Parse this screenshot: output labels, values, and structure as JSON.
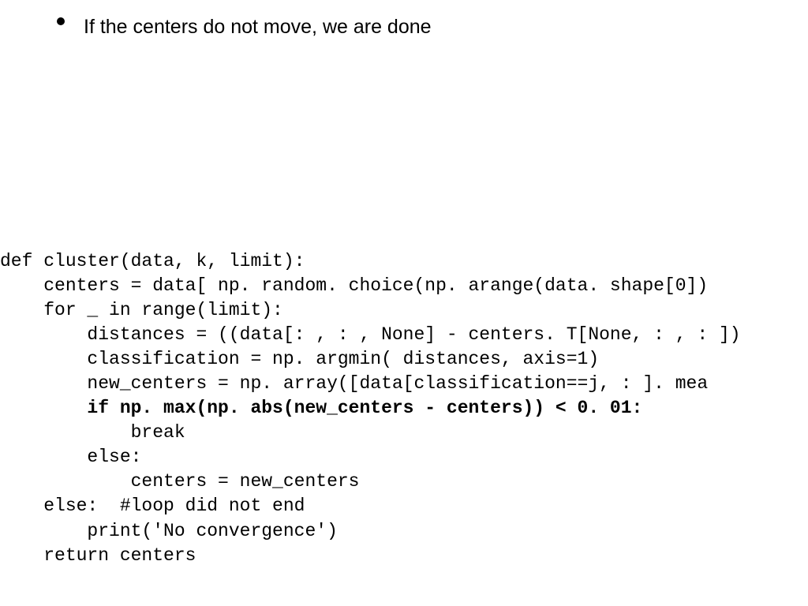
{
  "bullet": {
    "text": "If the centers do not move, we are done"
  },
  "code": {
    "line1": "def cluster(data, k, limit):",
    "line2": "    centers = data[ np. random. choice(np. arange(data. shape[0])",
    "line3": "    for _ in range(limit):",
    "line4": "        distances = ((data[: , : , None] - centers. T[None, : , : ])",
    "line5": "        classification = np. argmin( distances, axis=1)",
    "line6": "        new_centers = np. array([data[classification==j, : ]. mea",
    "line7": "        if np. max(np. abs(new_centers - centers)) < 0. 01:",
    "line8": "            break",
    "line9": "        else:",
    "line10": "            centers = new_centers",
    "line11": "    else:  #loop did not end",
    "line12": "        print('No convergence')",
    "line13": "    return centers"
  }
}
